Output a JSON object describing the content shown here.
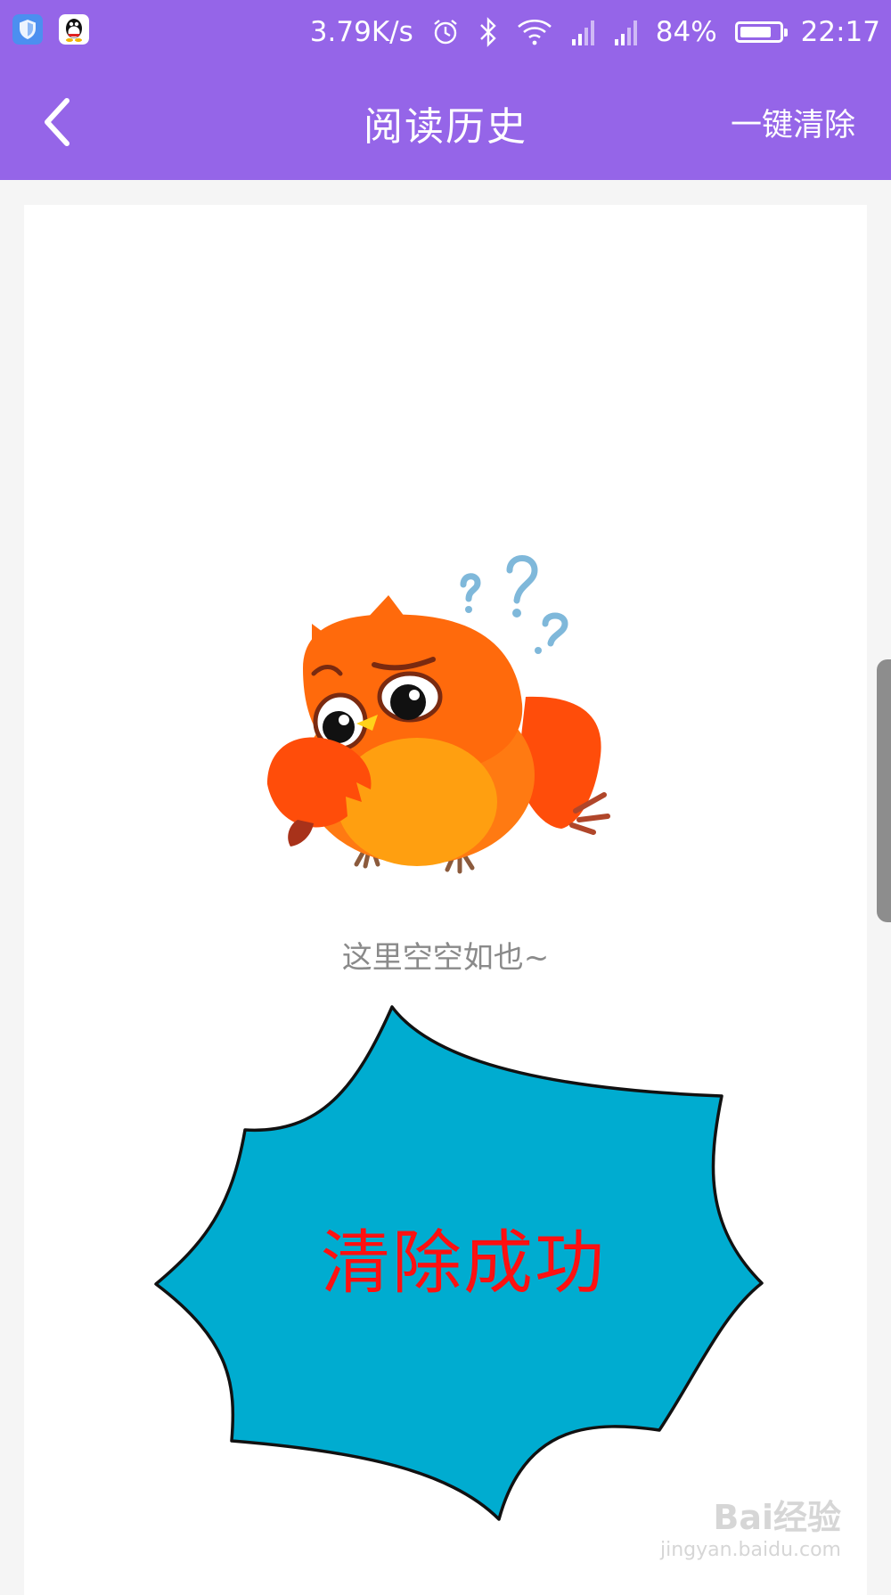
{
  "status_bar": {
    "network_speed": "3.79K/s",
    "battery_percent": "84%",
    "battery_level": 0.84,
    "time": "22:17",
    "icons": [
      "shield-app-icon",
      "qq-penguin-icon",
      "alarm-icon",
      "bluetooth-icon",
      "wifi-icon",
      "signal-icon",
      "signal-icon",
      "battery-icon"
    ]
  },
  "header": {
    "title": "阅读历史",
    "right_action": "一键清除",
    "back_icon": "chevron-left-icon"
  },
  "empty_state": {
    "illustration": "confused-owl",
    "message": "这里空空如也~"
  },
  "overlay": {
    "text": "清除成功",
    "shape": "burst-callout"
  },
  "watermark": {
    "brand": "Bai经验",
    "url": "jingyan.baidu.com"
  },
  "colors": {
    "header_bg": "#9565e8",
    "page_bg": "#f5f5f5",
    "burst_fill": "#00acd0",
    "burst_text": "#ff1010",
    "empty_text": "#8a8a8a"
  }
}
